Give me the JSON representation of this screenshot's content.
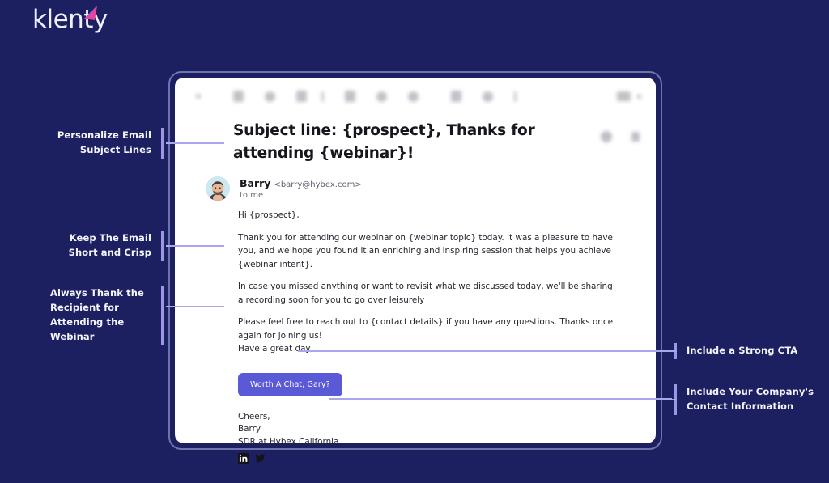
{
  "brand": {
    "name": "klenty",
    "accent_color": "#e8449b",
    "accent_color_2": "#7d5cf5",
    "background_color": "#1d2060"
  },
  "email_client": {
    "toolbar": {
      "icons": [
        "back-arrow-icon",
        "archive-icon",
        "report-spam-icon",
        "delete-icon",
        "mark-unread-icon",
        "snooze-icon",
        "add-task-icon",
        "move-to-icon",
        "labels-icon",
        "more-options-icon",
        "print-icon",
        "open-in-new-icon"
      ]
    },
    "subject": "Subject line: {prospect}, Thanks for attending {webinar}!",
    "subject_actions": [
      "star-icon",
      "print-icon"
    ],
    "sender": {
      "avatar": "sender-avatar",
      "name": "Barry",
      "email": "<barry@hybex.com>",
      "recipient_label": "to me"
    },
    "body": {
      "greeting": "Hi {prospect},",
      "paragraphs": [
        "Thank you for attending our webinar on {webinar topic} today. It was a pleasure to have you, and we hope you found it an enriching and inspiring session that helps you achieve {webinar intent}.",
        "In case you missed anything or want to revisit what we discussed today, we'll be sharing a recording soon for you to go over leisurely"
      ],
      "closing_paragraph": "Please feel free to reach out to {contact details} if you have any questions. Thanks once again for joining us!",
      "sign_off_line": "Have a great day,"
    },
    "cta": {
      "label": "Worth A Chat, Gary?",
      "color": "#5b5ad6"
    },
    "signature": {
      "line1": "Cheers,",
      "line2": "Barry",
      "line3": "SDR at Hybex California",
      "social_icons": [
        "linkedin-icon",
        "twitter-icon"
      ]
    }
  },
  "annotations": {
    "accent_color": "#9a97e4",
    "left": [
      {
        "id": "personalize-subject",
        "text": "Personalize Email Subject Lines",
        "lines": [
          "Personalize Email",
          "Subject Lines"
        ],
        "align": "right"
      },
      {
        "id": "keep-short",
        "text": "Keep The Email Short and Crisp",
        "lines": [
          "Keep The Email",
          "Short and Crisp"
        ],
        "align": "right"
      },
      {
        "id": "thank-recipient",
        "text": "Always Thank the Recipient for Attending the Webinar",
        "lines": [
          "Always Thank the",
          "Recipient for",
          "Attending the",
          "Webinar"
        ],
        "align": "left"
      }
    ],
    "right": [
      {
        "id": "strong-cta",
        "text": "Include a Strong CTA",
        "lines": [
          "Include a Strong CTA"
        ]
      },
      {
        "id": "contact-info",
        "text": "Include Your Company's Contact Information",
        "lines": [
          "Include Your Company's",
          "Contact Information"
        ]
      }
    ]
  }
}
